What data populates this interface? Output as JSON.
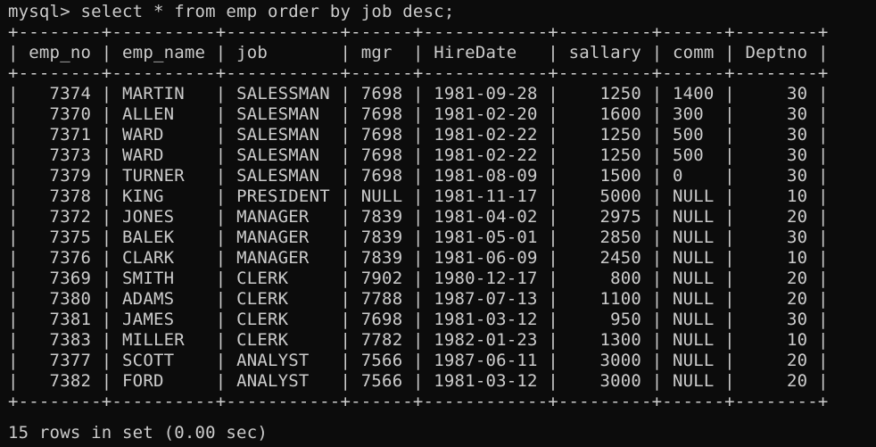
{
  "terminal": {
    "prompt": "mysql> ",
    "command": "select * from emp order by job desc;",
    "result_summary": "15 rows in set (0.00 sec)"
  },
  "table": {
    "columns": [
      "emp_no",
      "emp_name",
      "job",
      "mgr",
      "HireDate",
      "sallary",
      "comm",
      "Deptno"
    ],
    "rows": [
      [
        "7374",
        "MARTIN",
        "SALESSMAN",
        "7698",
        "1981-09-28",
        "1250",
        "1400",
        "30"
      ],
      [
        "7370",
        "ALLEN",
        "SALESMAN",
        "7698",
        "1981-02-20",
        "1600",
        "300",
        "30"
      ],
      [
        "7371",
        "WARD",
        "SALESMAN",
        "7698",
        "1981-02-22",
        "1250",
        "500",
        "30"
      ],
      [
        "7373",
        "WARD",
        "SALESMAN",
        "7698",
        "1981-02-22",
        "1250",
        "500",
        "30"
      ],
      [
        "7379",
        "TURNER",
        "SALESMAN",
        "7698",
        "1981-08-09",
        "1500",
        "0",
        "30"
      ],
      [
        "7378",
        "KING",
        "PRESIDENT",
        "NULL",
        "1981-11-17",
        "5000",
        "NULL",
        "10"
      ],
      [
        "7372",
        "JONES",
        "MANAGER",
        "7839",
        "1981-04-02",
        "2975",
        "NULL",
        "20"
      ],
      [
        "7375",
        "BALEK",
        "MANAGER",
        "7839",
        "1981-05-01",
        "2850",
        "NULL",
        "30"
      ],
      [
        "7376",
        "CLARK",
        "MANAGER",
        "7839",
        "1981-06-09",
        "2450",
        "NULL",
        "10"
      ],
      [
        "7369",
        "SMITH",
        "CLERK",
        "7902",
        "1980-12-17",
        "800",
        "NULL",
        "20"
      ],
      [
        "7380",
        "ADAMS",
        "CLERK",
        "7788",
        "1987-07-13",
        "1100",
        "NULL",
        "20"
      ],
      [
        "7381",
        "JAMES",
        "CLERK",
        "7698",
        "1981-03-12",
        "950",
        "NULL",
        "30"
      ],
      [
        "7383",
        "MILLER",
        "CLERK",
        "7782",
        "1982-01-23",
        "1300",
        "NULL",
        "10"
      ],
      [
        "7377",
        "SCOTT",
        "ANALYST",
        "7566",
        "1987-06-11",
        "3000",
        "NULL",
        "20"
      ],
      [
        "7382",
        "FORD",
        "ANALYST",
        "7566",
        "1981-03-12",
        "3000",
        "NULL",
        "20"
      ]
    ]
  }
}
